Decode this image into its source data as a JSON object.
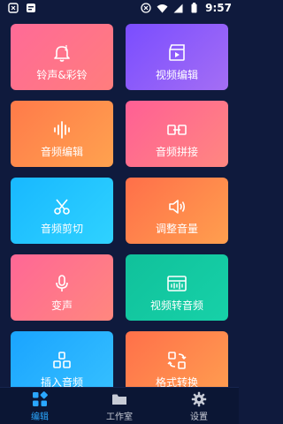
{
  "status_bar": {
    "time": "9:57",
    "left_icons": [
      "app-icon",
      "notification-icon"
    ],
    "right_icons": [
      "alarm-icon",
      "wifi-icon",
      "signal-icon",
      "battery-icon"
    ]
  },
  "tiles": [
    {
      "label": "铃声&彩铃",
      "icon": "ringtone-icon"
    },
    {
      "label": "视频编辑",
      "icon": "video-edit-icon"
    },
    {
      "label": "音频编辑",
      "icon": "audio-wave-icon"
    },
    {
      "label": "音频拼接",
      "icon": "audio-join-icon"
    },
    {
      "label": "音频剪切",
      "icon": "scissors-icon"
    },
    {
      "label": "调整音量",
      "icon": "volume-icon"
    },
    {
      "label": "变声",
      "icon": "microphone-icon"
    },
    {
      "label": "视频转音频",
      "icon": "video-to-audio-icon"
    },
    {
      "label": "插入音频",
      "icon": "insert-audio-icon"
    },
    {
      "label": "格式转换",
      "icon": "format-convert-icon"
    }
  ],
  "bottom_nav": {
    "items": [
      {
        "label": "编辑",
        "icon": "grid-icon",
        "active": true
      },
      {
        "label": "工作室",
        "icon": "folder-icon",
        "active": false
      },
      {
        "label": "设置",
        "icon": "gear-icon",
        "active": false
      }
    ]
  },
  "colors": {
    "background": "#0f1a3d",
    "active_nav": "#2aa7ff",
    "inactive_nav": "#c7cbd6"
  }
}
